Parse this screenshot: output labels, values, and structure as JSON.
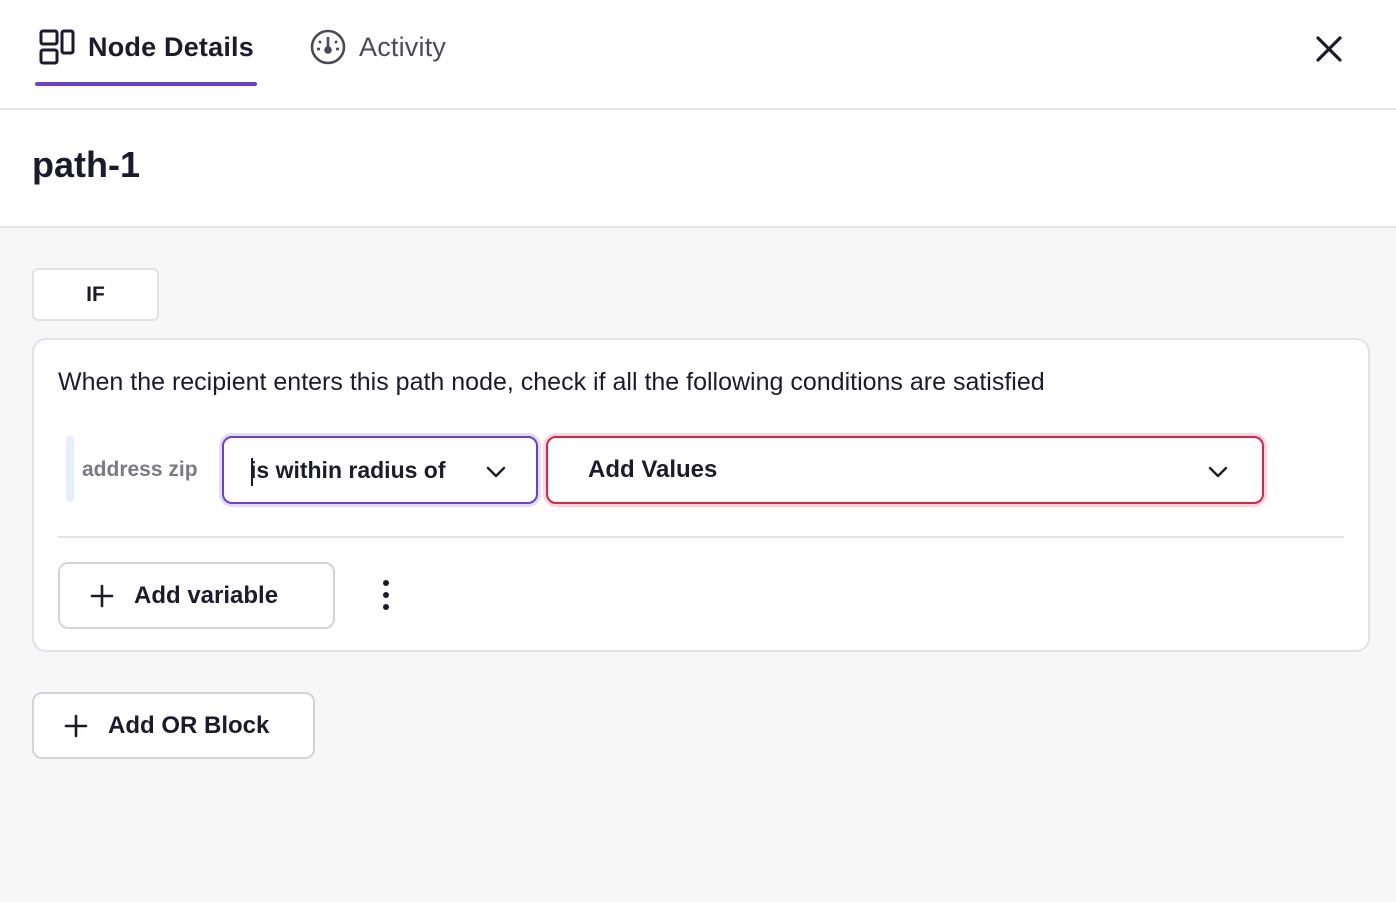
{
  "header": {
    "tabs": [
      {
        "label": "Node Details",
        "icon": "layout-icon",
        "active": true
      },
      {
        "label": "Activity",
        "icon": "gauge-icon",
        "active": false
      }
    ],
    "close_icon": "close-icon"
  },
  "node": {
    "title": "path-1"
  },
  "condition_block": {
    "if_label": "IF",
    "description": "When the recipient enters this path node, check if all the following conditions are satisfied",
    "rule": {
      "variable": "address zip",
      "operator": "is within radius of",
      "values_placeholder": "Add Values"
    },
    "add_variable_label": "Add variable"
  },
  "add_or_block_label": "Add OR Block",
  "colors": {
    "accent": "#6a3fd8",
    "error": "#d9234a",
    "text": "#1c1b2e"
  }
}
